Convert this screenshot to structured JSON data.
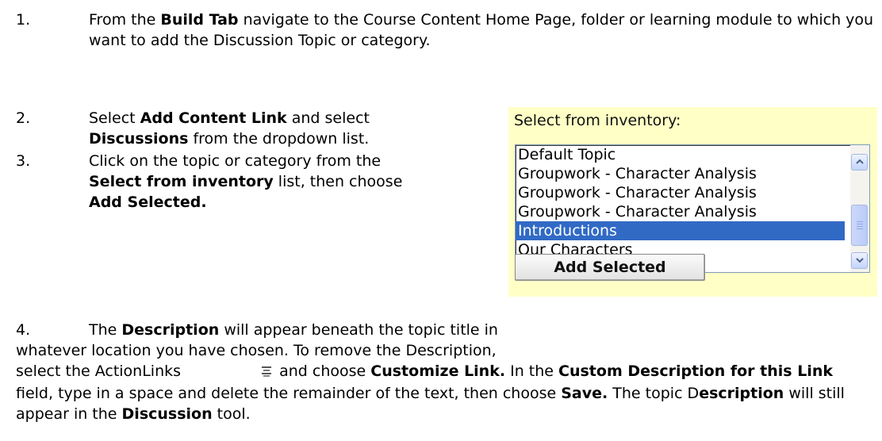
{
  "steps": [
    {
      "number": "1.",
      "parts": [
        "From the ",
        {
          "b": "Build Tab"
        },
        " navigate to the Course Content Home Page, folder or learning module to which you want to add the Discussion Topic or category."
      ]
    },
    {
      "number": "2.",
      "parts": [
        "Select ",
        {
          "b": "Add Content Link"
        },
        " and select ",
        {
          "b": "Discussions"
        },
        " from the dropdown list."
      ]
    },
    {
      "number": "3.",
      "parts": [
        "Click on the topic or category from the ",
        {
          "b": "Select from inventory"
        },
        " list, then choose ",
        {
          "b": "Add Selected."
        }
      ]
    },
    {
      "number": "4.",
      "parts": [
        "The ",
        {
          "b": "Description"
        },
        " will appear beneath the topic title in whatever location you have chosen.  To remove the Description, select the ActionLinks ",
        {
          "icon": "actionlinks-icon"
        },
        " and choose ",
        {
          "b": "Customize Link."
        },
        "  In the ",
        {
          "b": "Custom Description for this Link"
        },
        " field, type in a space and delete the remainder of the text, then choose ",
        {
          "b": "Save."
        },
        " The topic D",
        {
          "b": "escription"
        },
        " will still appear in the ",
        {
          "b": "Discussion"
        },
        " tool."
      ]
    }
  ],
  "inventory": {
    "title": "Select from inventory:",
    "items": [
      "Default Topic",
      "Groupwork - Character Analysis",
      "Groupwork - Character Analysis",
      "Groupwork - Character Analysis",
      "Introductions",
      "Our Characters"
    ],
    "selected_index": 4,
    "scroll_position": 0.6,
    "button_label": "Add Selected",
    "background_color": "#ffffc6",
    "selection_color": "#316ac5"
  }
}
